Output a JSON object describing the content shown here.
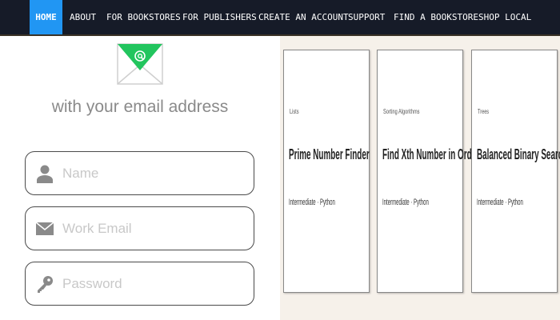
{
  "nav": {
    "items": [
      {
        "label": "HOME",
        "active": true
      },
      {
        "label": "ABOUT"
      },
      {
        "label": "FOR BOOKSTORES"
      },
      {
        "label": "FOR PUBLISHERS"
      },
      {
        "label": "CREATE AN ACCOUNT"
      },
      {
        "label": "SUPPORT"
      },
      {
        "label": "FIND A BOOKSTORE"
      },
      {
        "label": "SHOP LOCAL"
      }
    ],
    "active_color": "#2196f3",
    "background": "#161b28"
  },
  "signup": {
    "icon": "email-icon",
    "icon_accent": "#22c55e",
    "subtitle": "with your email address",
    "fields": {
      "name": {
        "placeholder": "Name",
        "value": "",
        "icon": "user-icon"
      },
      "work_email": {
        "placeholder": "Work Email",
        "value": "",
        "icon": "envelope-icon"
      },
      "password": {
        "placeholder": "Password",
        "value": "",
        "icon": "key-icon"
      }
    }
  },
  "cards": [
    {
      "category": "Lists",
      "title": "Prime Number Finder",
      "meta": "Intermediate · Python"
    },
    {
      "category": "Sorting Algorithms",
      "title": "Find Xth Number in Order",
      "meta": "Intermediate · Python"
    },
    {
      "category": "Trees",
      "title": "Balanced Binary Search Tree",
      "meta": "Intermediate · Python"
    }
  ]
}
